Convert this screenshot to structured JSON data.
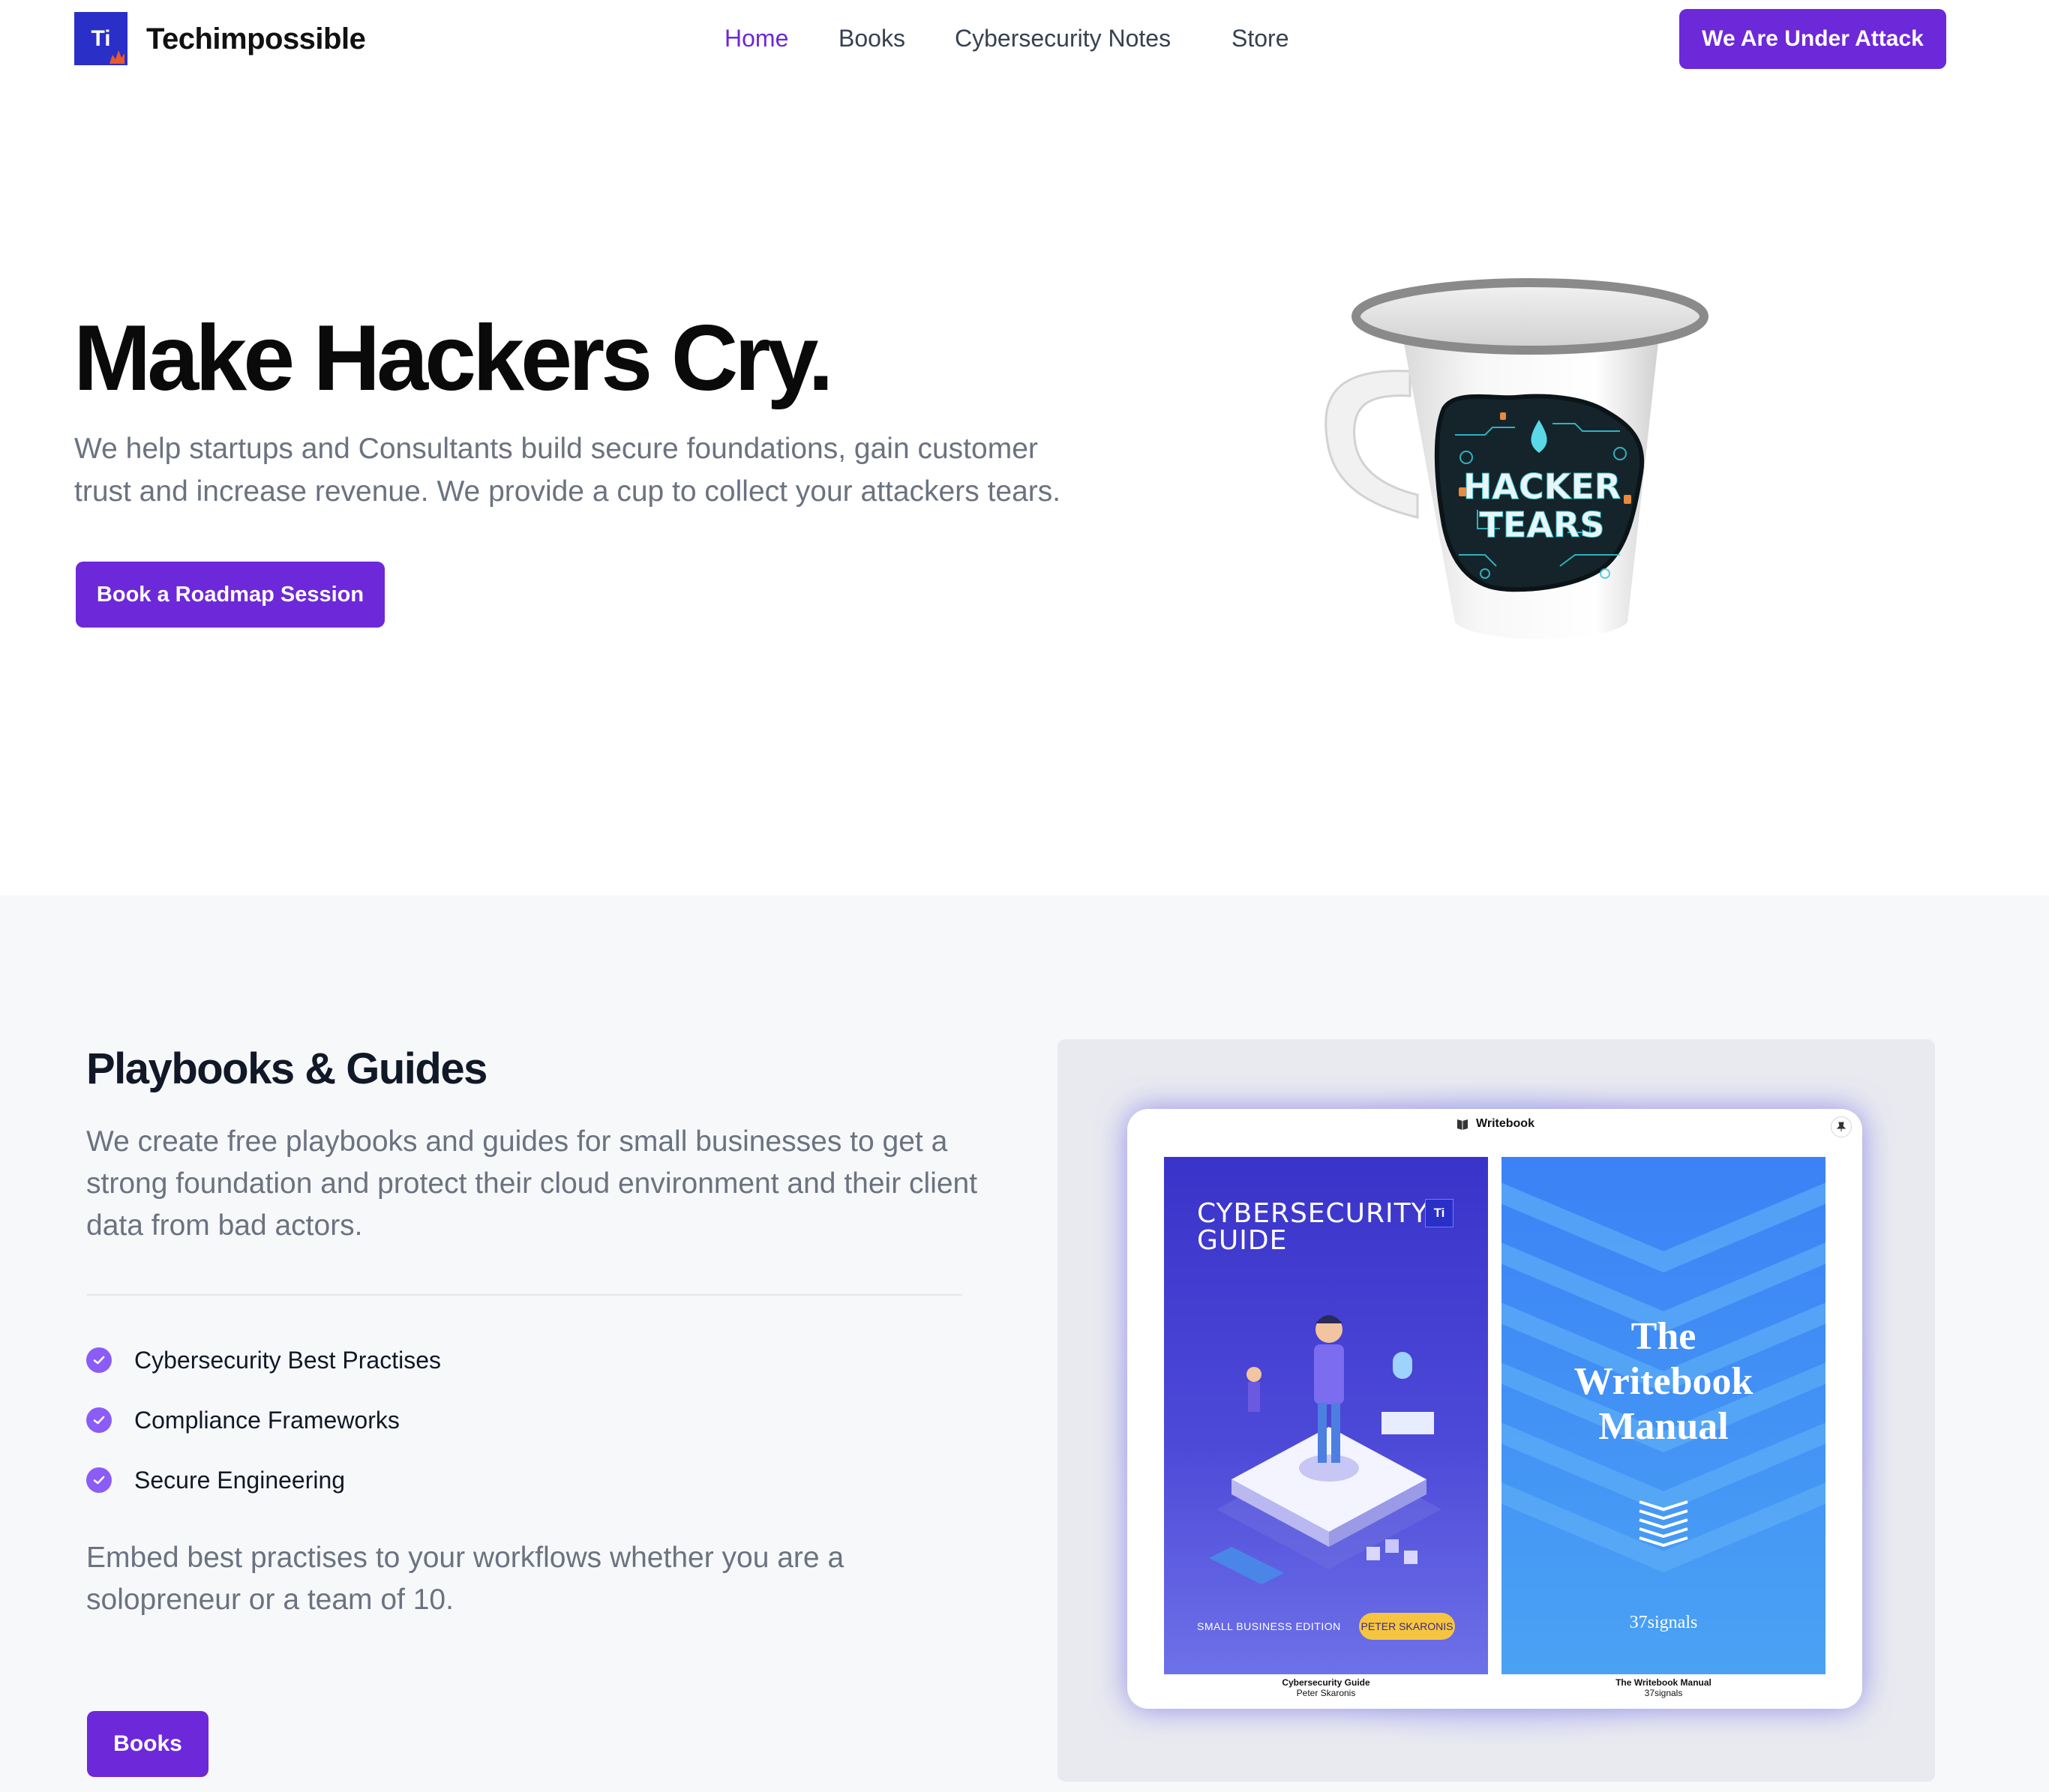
{
  "brand": {
    "logo_text": "Ti",
    "name": "Techimpossible"
  },
  "nav": {
    "items": [
      {
        "label": "Home",
        "active": true
      },
      {
        "label": "Books",
        "active": false
      },
      {
        "label": "Cybersecurity Notes",
        "active": false
      },
      {
        "label": "Store",
        "active": false
      }
    ],
    "cta": "We Are Under Attack"
  },
  "hero": {
    "title": "Make Hackers Cry.",
    "subtitle": "We help startups and Consultants build secure foundations, gain customer trust and increase revenue. We provide a cup to collect your attackers tears.",
    "cta": "Book a Roadmap Session",
    "mug_text": [
      "HACKER",
      "TEARS"
    ]
  },
  "playbooks": {
    "title": "Playbooks & Guides",
    "description": "We create free playbooks and guides for small businesses to get a strong foundation and protect their cloud environment and their client data from bad actors.",
    "features": [
      "Cybersecurity Best Practises",
      "Compliance Frameworks",
      "Secure Engineering"
    ],
    "embed_text": "Embed best practises to your workflows whether you are a solopreneur or a team of 10.",
    "cta": "Books"
  },
  "writebook": {
    "app_name": "Writebook",
    "books": [
      {
        "cover_title": "CYBERSECURITY GUIDE",
        "cover_logo": "Ti",
        "edition": "SMALL BUSINESS EDITION",
        "author_badge": "PETER SKARONIS",
        "caption_title": "Cybersecurity Guide",
        "caption_author": "Peter Skaronis"
      },
      {
        "cover_title": "The Writebook Manual",
        "publisher": "37signals",
        "caption_title": "The Writebook Manual",
        "caption_author": "37signals"
      }
    ]
  },
  "colors": {
    "accent": "#6d28d9",
    "logo_bg": "#2a2fc7",
    "section_bg": "#f7f8fa",
    "check": "#8b5cf6"
  }
}
